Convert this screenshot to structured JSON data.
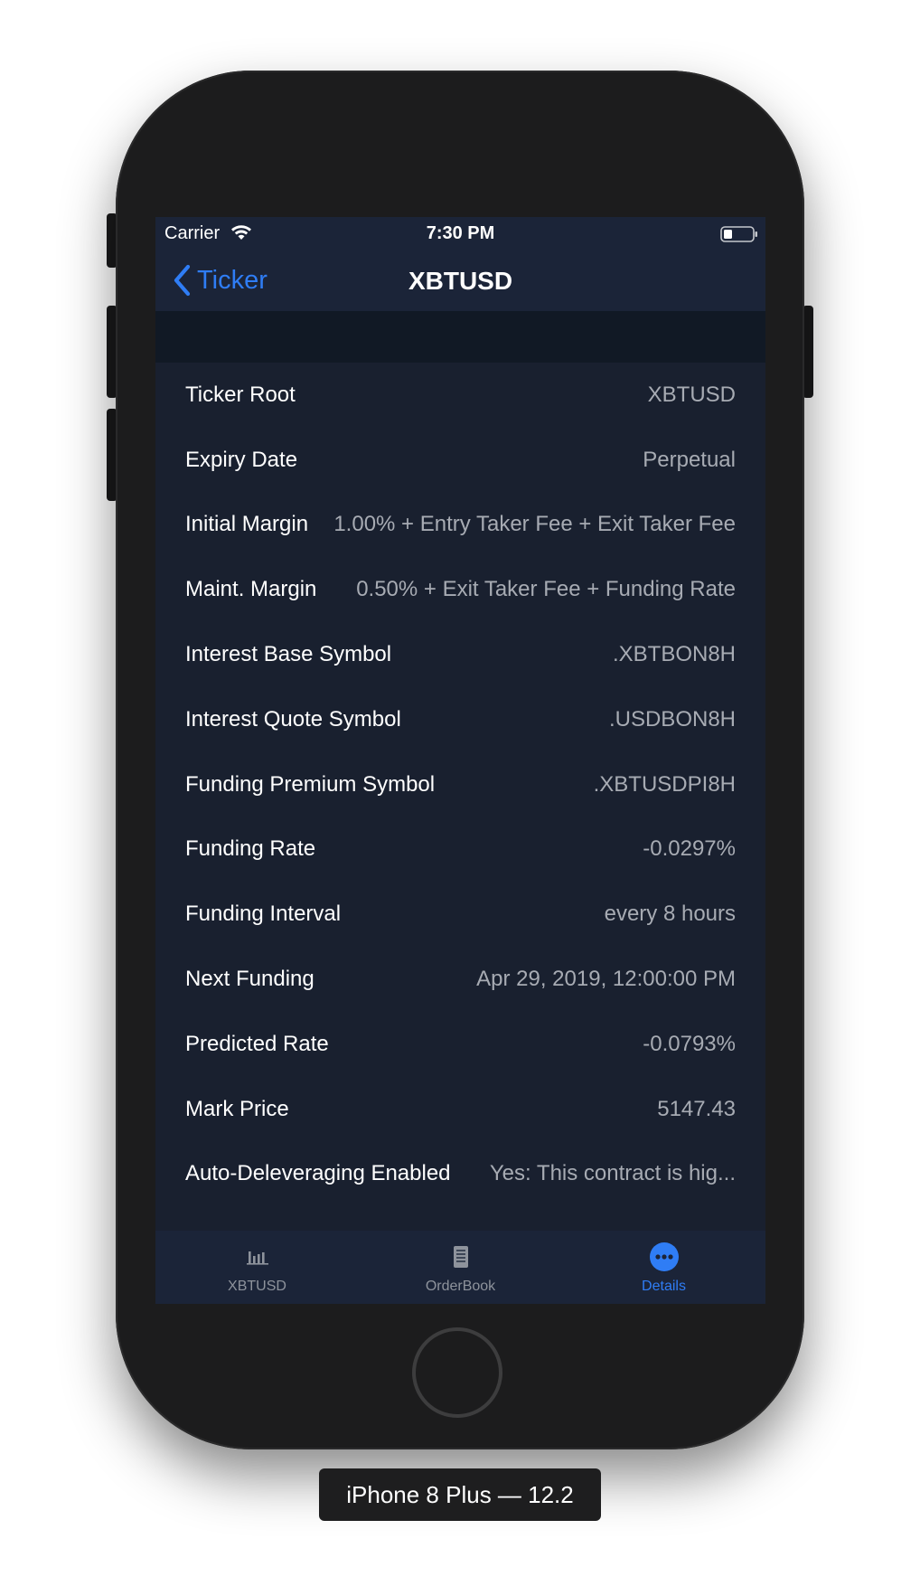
{
  "status_bar": {
    "carrier": "Carrier",
    "time": "7:30 PM"
  },
  "nav": {
    "back_label": "Ticker",
    "title": "XBTUSD"
  },
  "details": [
    {
      "label": "Ticker Root",
      "value": "XBTUSD"
    },
    {
      "label": "Expiry Date",
      "value": "Perpetual"
    },
    {
      "label": "Initial Margin",
      "value": "1.00% + Entry Taker Fee + Exit Taker Fee"
    },
    {
      "label": "Maint. Margin",
      "value": "0.50% + Exit Taker Fee + Funding Rate"
    },
    {
      "label": "Interest Base Symbol",
      "value": ".XBTBON8H"
    },
    {
      "label": "Interest Quote Symbol",
      "value": ".USDBON8H"
    },
    {
      "label": "Funding Premium Symbol",
      "value": ".XBTUSDPI8H"
    },
    {
      "label": "Funding Rate",
      "value": "-0.0297%"
    },
    {
      "label": "Funding Interval",
      "value": "every 8 hours"
    },
    {
      "label": "Next Funding",
      "value": "Apr 29, 2019, 12:00:00 PM"
    },
    {
      "label": "Predicted Rate",
      "value": "-0.0793%"
    },
    {
      "label": "Mark Price",
      "value": "5147.43"
    },
    {
      "label": "Auto-Deleveraging Enabled",
      "value": "Yes: This contract is hig..."
    }
  ],
  "tabs": [
    {
      "label": "XBTUSD",
      "icon": "bar-chart-icon",
      "active": false
    },
    {
      "label": "OrderBook",
      "icon": "document-icon",
      "active": false
    },
    {
      "label": "Details",
      "icon": "more-icon",
      "active": true
    }
  ],
  "device_label": "iPhone 8 Plus — 12.2",
  "colors": {
    "accent": "#2f7df5",
    "background": "#19202f",
    "bar": "#1b2438",
    "section_header": "#111925",
    "secondary_text": "#a7abb3",
    "tab_inactive": "#8e939c"
  }
}
